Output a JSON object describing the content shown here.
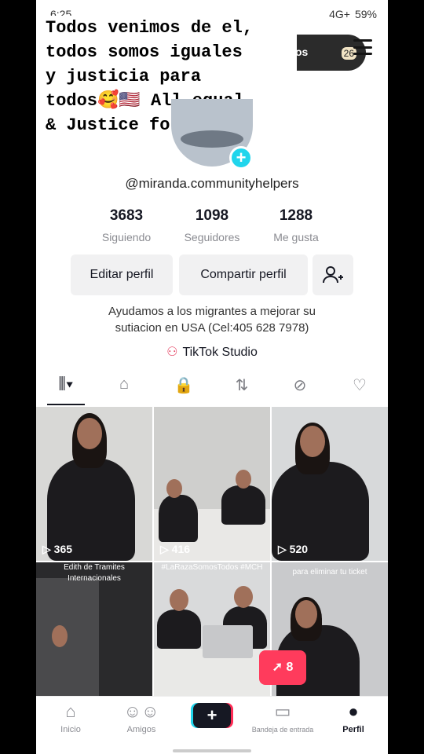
{
  "status_bar": {
    "time": "6:25",
    "signal": "4G+",
    "battery": "59%"
  },
  "caption": "Todos venimos de el,\ntodos somos iguales\ny justicia para\ntodos🥰🇺🇸 All equal\n& Justice for All!",
  "header_pill": {
    "text": "os",
    "count": "26"
  },
  "profile": {
    "handle": "@miranda.communityhelpers",
    "stats": [
      {
        "value": "3683",
        "label": "Siguiendo"
      },
      {
        "value": "1098",
        "label": "Seguidores"
      },
      {
        "value": "1288",
        "label": "Me gusta"
      }
    ],
    "edit_label": "Editar perfil",
    "share_label": "Compartir perfil",
    "bio_line1": "Ayudamos a los migrantes a mejorar su",
    "bio_line2": "sutiacion en USA (Cel:405 628 7978)",
    "studio_label": "TikTok Studio"
  },
  "tabs": [
    {
      "icon": "grid-icon",
      "glyph": "⫼▾"
    },
    {
      "icon": "store-icon",
      "glyph": "⌂"
    },
    {
      "icon": "lock-icon",
      "glyph": "🔒"
    },
    {
      "icon": "repost-icon",
      "glyph": "⇅"
    },
    {
      "icon": "hidden-icon",
      "glyph": "⊘"
    },
    {
      "icon": "liked-icon",
      "glyph": "♡"
    }
  ],
  "videos": [
    {
      "views": "365",
      "overlay": ""
    },
    {
      "views": "416",
      "overlay": ""
    },
    {
      "views": "520",
      "overlay": ""
    },
    {
      "views": "",
      "overlay": "Edith de Tramites Internacionales"
    },
    {
      "views": "",
      "overlay": "#LaRazaSomosTodos #MCH"
    },
    {
      "views": "",
      "overlay": "para eliminar tu ticket"
    }
  ],
  "live_badge": "8",
  "bottom_nav": {
    "home": "Inicio",
    "friends": "Amigos",
    "create": "+",
    "inbox": "Bandeja de entrada",
    "profile": "Perfil"
  },
  "colors": {
    "accent_cyan": "#20d5ec",
    "accent_red": "#fe2c55"
  }
}
